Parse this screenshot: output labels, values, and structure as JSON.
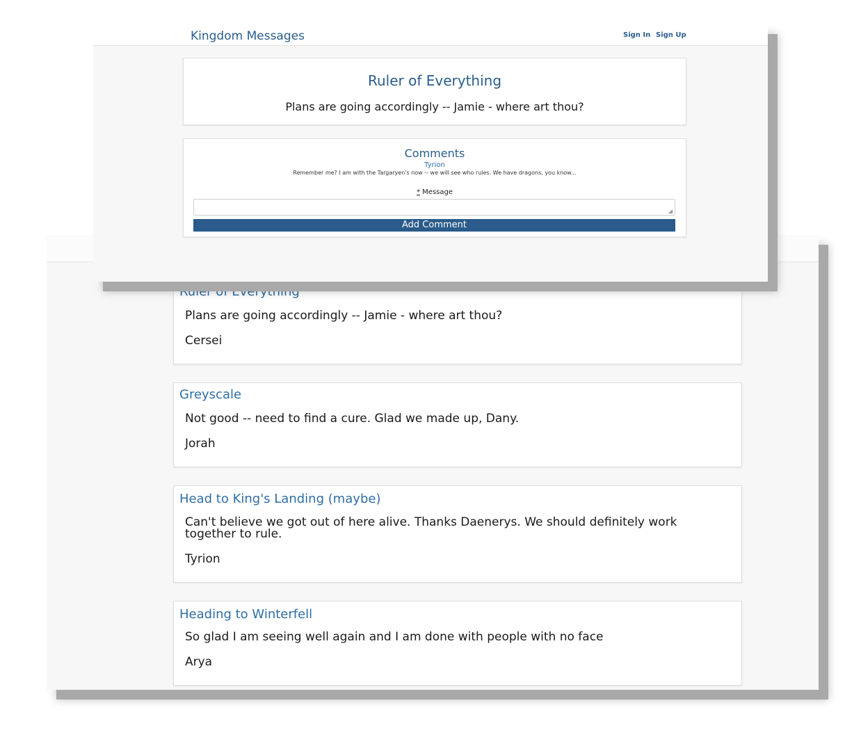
{
  "front": {
    "nav": {
      "brand": "Kingdom Messages",
      "sign_in": "Sign In",
      "sign_up": "Sign Up"
    },
    "detail": {
      "title": "Ruler of Everything",
      "body": "Plans are going accordingly -- Jamie - where art thou?"
    },
    "comments": {
      "heading": "Comments",
      "items": [
        {
          "author": "Tyrion",
          "text": "Remember me? I am with the Targaryen's now -- we will see who rules. We have dragons, you know..."
        }
      ],
      "form": {
        "required_mark": "*",
        "label": "Message",
        "message_value": "",
        "submit_label": "Add Comment"
      }
    }
  },
  "back": {
    "messages": [
      {
        "title": "Ruler of Everything",
        "body": "Plans are going accordingly -- Jamie - where art thou?",
        "author": "Cersei"
      },
      {
        "title": "Greyscale",
        "body": "Not good -- need to find a cure. Glad we made up, Dany.",
        "author": "Jorah"
      },
      {
        "title": "Head to King's Landing (maybe)",
        "body": "Can't believe we got out of here alive. Thanks Daenerys. We should definitely work together to rule.",
        "author": "Tyrion"
      },
      {
        "title": "Heading to Winterfell",
        "body": "So glad I am seeing well again and I am done with people with no face",
        "author": "Arya"
      }
    ]
  }
}
